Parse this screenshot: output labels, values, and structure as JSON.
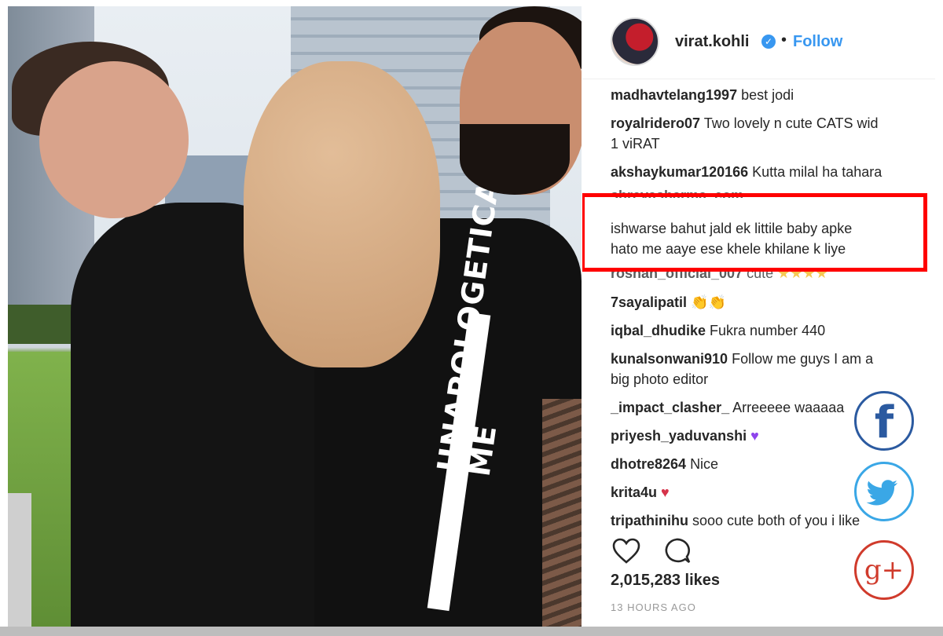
{
  "header": {
    "username": "virat.kohli",
    "verified_icon": "verified-badge-icon",
    "separator": "•",
    "follow_label": "Follow"
  },
  "photo": {
    "shirt_text_line1": "UNAPOLOGETICALLY",
    "shirt_text_line2": "ME"
  },
  "comments": [
    {
      "user": "madhavtelang1997",
      "text": "best jodi"
    },
    {
      "user": "royalridero07",
      "text": "Two lovely n cute CATS wid",
      "text2": "1 viRAT"
    },
    {
      "user": "akshaykumar120166",
      "text": "Kutta milal ha tahara"
    },
    {
      "user": "shreyasharma_com",
      "text": ""
    },
    {
      "user": "ishwarse",
      "text": "bahut jald ek littile baby apke",
      "text2": "hato me aaye ese khele khilane k liye"
    },
    {
      "user": "roshan_official_007",
      "text": "cute"
    },
    {
      "user": "7sayalipatil",
      "text": ""
    },
    {
      "user": "iqbal_dhudike",
      "text": "Fukra number 440"
    },
    {
      "user": "kunalsonwani910",
      "text": "Follow me guys I am a",
      "text2": "big photo editor"
    },
    {
      "user": "_impact_clasher_",
      "text": "Arreeeee waaaaa"
    },
    {
      "user": "priyesh_yaduvanshi",
      "text": ""
    },
    {
      "user": "dhotre8264",
      "text": "Nice"
    },
    {
      "user": "krita4u",
      "text": ""
    },
    {
      "user": "tripathinihu",
      "text": "sooo cute both of you i like"
    }
  ],
  "emoji": {
    "stars": "★★★★",
    "hands": "👏👏",
    "purple_heart": "♥",
    "broken_heart": "♥"
  },
  "actions": {
    "like_icon": "heart-icon",
    "comment_icon": "comment-bubble-icon"
  },
  "likes": "2,015,283 likes",
  "timestamp": "13 HOURS AGO",
  "share": {
    "facebook_glyph": "f",
    "google_plus_glyph": "g+"
  },
  "colors": {
    "follow": "#3897f0",
    "highlight": "#ff0000"
  }
}
